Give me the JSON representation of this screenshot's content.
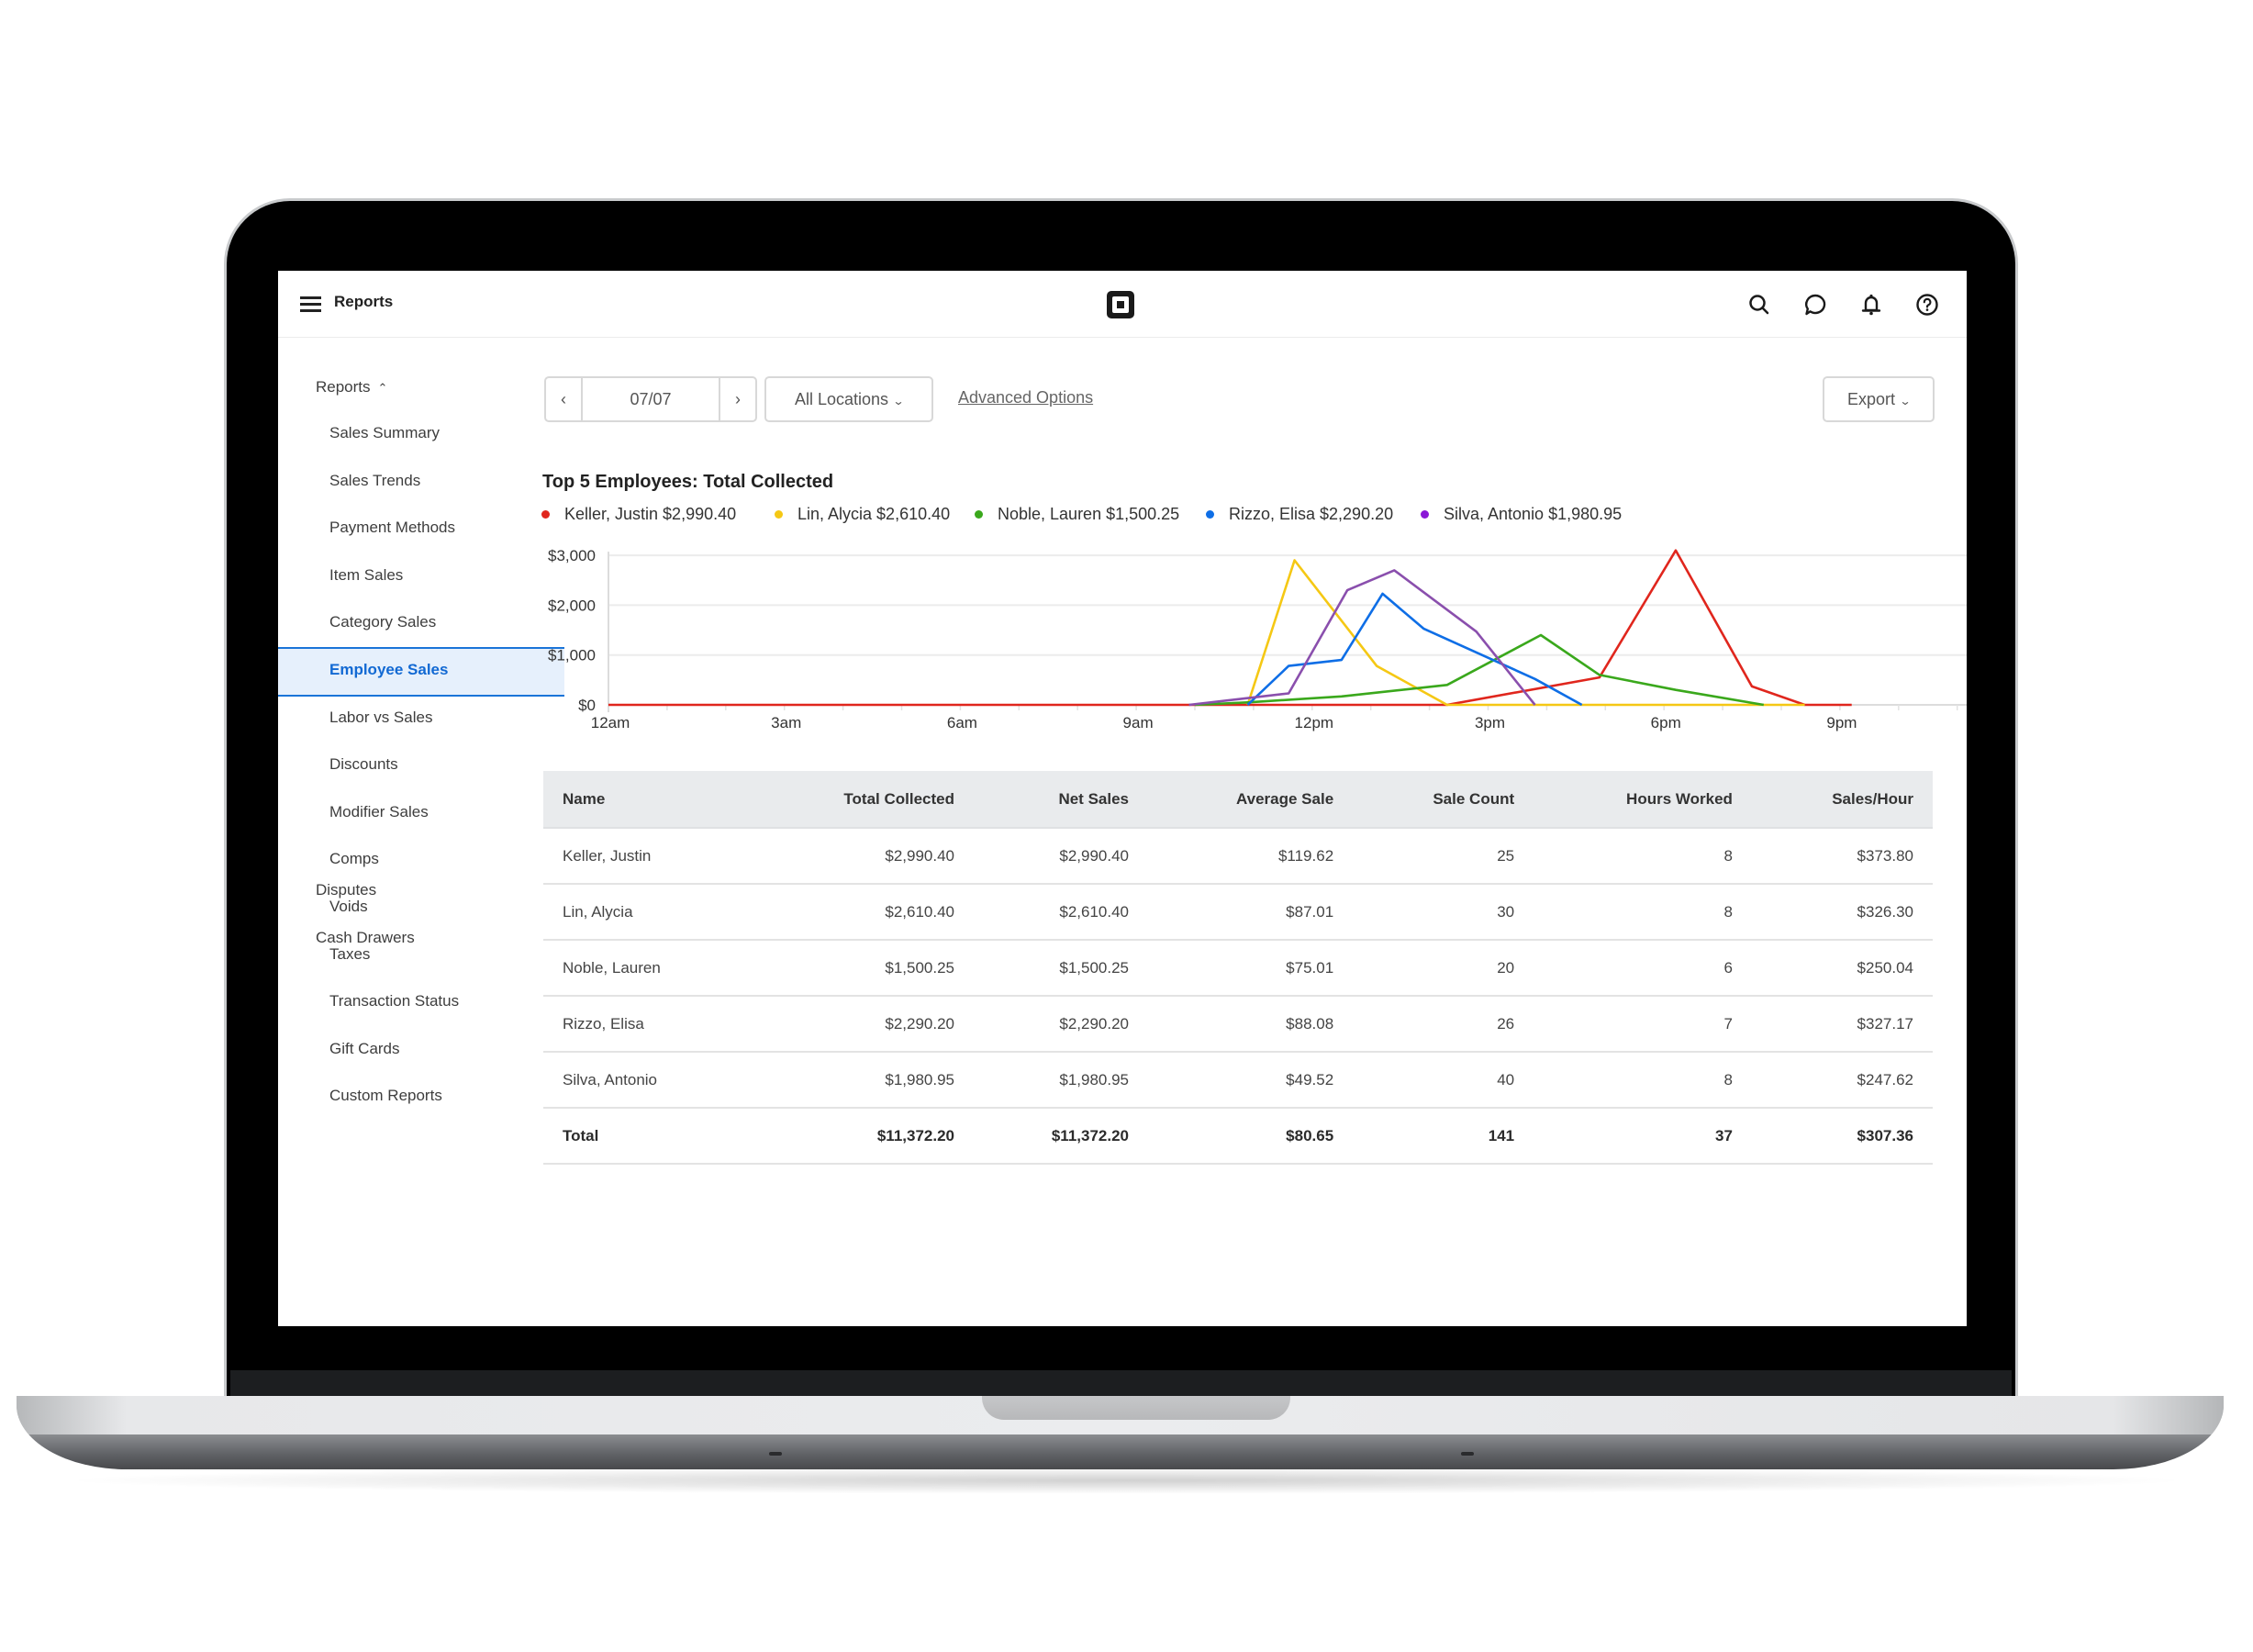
{
  "header": {
    "title": "Reports",
    "icons": [
      "menu-icon",
      "square-logo",
      "search-icon",
      "chat-icon",
      "bell-icon",
      "help-icon"
    ]
  },
  "sidebar": {
    "section_label": "Reports",
    "section_expanded": true,
    "items": [
      {
        "label": "Sales Summary",
        "active": false
      },
      {
        "label": "Sales Trends",
        "active": false
      },
      {
        "label": "Payment Methods",
        "active": false
      },
      {
        "label": "Item Sales",
        "active": false
      },
      {
        "label": "Category Sales",
        "active": false
      },
      {
        "label": "Employee Sales",
        "active": true
      },
      {
        "label": "Labor vs Sales",
        "active": false
      },
      {
        "label": "Discounts",
        "active": false
      },
      {
        "label": "Modifier Sales",
        "active": false
      },
      {
        "label": "Comps",
        "active": false
      },
      {
        "label": "Voids",
        "active": false
      },
      {
        "label": "Taxes",
        "active": false
      },
      {
        "label": "Transaction Status",
        "active": false
      },
      {
        "label": "Gift Cards",
        "active": false
      },
      {
        "label": "Custom Reports",
        "active": false
      }
    ],
    "other_sections": [
      {
        "label": "Disputes"
      },
      {
        "label": "Cash Drawers"
      }
    ]
  },
  "toolbar": {
    "date_value": "07/07",
    "location_select": "All Locations",
    "advanced_options_label": "Advanced Options",
    "export_label": "Export"
  },
  "chart_data": {
    "type": "line",
    "title": "Top 5 Employees: Total Collected",
    "xlabel": "",
    "ylabel": "",
    "x_unit": "hour of day",
    "x_range": [
      0,
      24
    ],
    "x_ticks": [
      {
        "hour": 0,
        "label": "12am"
      },
      {
        "hour": 3,
        "label": "3am"
      },
      {
        "hour": 6,
        "label": "6am"
      },
      {
        "hour": 9,
        "label": "9am"
      },
      {
        "hour": 12,
        "label": "12pm"
      },
      {
        "hour": 15,
        "label": "3pm"
      },
      {
        "hour": 18,
        "label": "6pm"
      },
      {
        "hour": 21,
        "label": "9pm"
      }
    ],
    "ylim": [
      0,
      3000
    ],
    "y_ticks": [
      {
        "value": 0,
        "label": "$0"
      },
      {
        "value": 1000,
        "label": "$1,000"
      },
      {
        "value": 2000,
        "label": "$2,000"
      },
      {
        "value": 3000,
        "label": "$3,000"
      }
    ],
    "grid": true,
    "legend_position": "top-left",
    "series": [
      {
        "name": "Keller, Justin",
        "legend_label": "Keller, Justin $2,990.40",
        "color": "#e0261d",
        "points": [
          [
            0,
            0
          ],
          [
            14.3,
            0
          ],
          [
            16.9,
            550
          ],
          [
            18.2,
            3100
          ],
          [
            19.5,
            370
          ],
          [
            20.4,
            0
          ],
          [
            21.2,
            0
          ]
        ]
      },
      {
        "name": "Lin, Alycia",
        "legend_label": "Lin, Alycia $2,610.40",
        "color": "#f5c814",
        "points": [
          [
            10.9,
            0
          ],
          [
            11.7,
            2900
          ],
          [
            13.1,
            780
          ],
          [
            14.3,
            0
          ],
          [
            20.4,
            0
          ]
        ]
      },
      {
        "name": "Noble, Lauren",
        "legend_label": "Noble, Lauren $1,500.25",
        "color": "#3aa81c",
        "points": [
          [
            10.0,
            0
          ],
          [
            10.9,
            50
          ],
          [
            12.5,
            170
          ],
          [
            14.3,
            400
          ],
          [
            15.9,
            1400
          ],
          [
            16.9,
            600
          ],
          [
            18.2,
            300
          ],
          [
            19.7,
            0
          ]
        ]
      },
      {
        "name": "Rizzo, Elisa",
        "legend_label": "Rizzo, Elisa $2,290.20",
        "color": "#0e6ee6",
        "points": [
          [
            10.9,
            0
          ],
          [
            11.6,
            780
          ],
          [
            12.5,
            900
          ],
          [
            13.2,
            2230
          ],
          [
            13.9,
            1530
          ],
          [
            15.8,
            520
          ],
          [
            16.6,
            0
          ]
        ]
      },
      {
        "name": "Silva, Antonio",
        "legend_label": "Silva, Antonio $1,980.95",
        "color": "#8a4fad",
        "points": [
          [
            9.9,
            0
          ],
          [
            11.6,
            230
          ],
          [
            12.6,
            2300
          ],
          [
            13.4,
            2700
          ],
          [
            14.8,
            1470
          ],
          [
            15.8,
            0
          ]
        ]
      }
    ],
    "legend_dot_colors": [
      "#e0261d",
      "#f5c814",
      "#3aa81c",
      "#0e6ee6",
      "#8a17d6"
    ]
  },
  "table": {
    "columns": [
      "Name",
      "Total Collected",
      "Net Sales",
      "Average Sale",
      "Sale Count",
      "Hours Worked",
      "Sales/Hour"
    ],
    "rows": [
      [
        "Keller, Justin",
        "$2,990.40",
        "$2,990.40",
        "$119.62",
        "25",
        "8",
        "$373.80"
      ],
      [
        "Lin, Alycia",
        "$2,610.40",
        "$2,610.40",
        "$87.01",
        "30",
        "8",
        "$326.30"
      ],
      [
        "Noble, Lauren",
        "$1,500.25",
        "$1,500.25",
        "$75.01",
        "20",
        "6",
        "$250.04"
      ],
      [
        "Rizzo, Elisa",
        "$2,290.20",
        "$2,290.20",
        "$88.08",
        "26",
        "7",
        "$327.17"
      ],
      [
        "Silva, Antonio",
        "$1,980.95",
        "$1,980.95",
        "$49.52",
        "40",
        "8",
        "$247.62"
      ]
    ],
    "total": [
      "Total",
      "$11,372.20",
      "$11,372.20",
      "$80.65",
      "141",
      "37",
      "$307.36"
    ]
  },
  "colors": {
    "active_nav": "#1269d3",
    "active_nav_bg": "#e6f0fc",
    "table_header_bg": "#e9ebed"
  }
}
